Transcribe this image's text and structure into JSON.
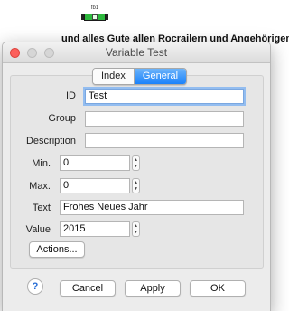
{
  "background": {
    "widget_label": "fb1",
    "message": "und alles Gute allen Rocrailern und Angehörigen!"
  },
  "dialog": {
    "title": "Variable Test",
    "tabs": [
      {
        "label": "Index",
        "active": false
      },
      {
        "label": "General",
        "active": true
      }
    ],
    "fields": {
      "id": {
        "label": "ID",
        "value": "Test"
      },
      "group": {
        "label": "Group",
        "value": ""
      },
      "description": {
        "label": "Description",
        "value": ""
      },
      "min": {
        "label": "Min.",
        "value": "0"
      },
      "max": {
        "label": "Max.",
        "value": "0"
      },
      "text": {
        "label": "Text",
        "value": "Frohes Neues Jahr"
      },
      "value": {
        "label": "Value",
        "value": "2015"
      }
    },
    "actions_label": "Actions...",
    "help_label": "?",
    "buttons": {
      "cancel": "Cancel",
      "apply": "Apply",
      "ok": "OK"
    }
  },
  "colors": {
    "accent": "#1a82fb",
    "close": "#fc605c",
    "widget": "#2db83d"
  }
}
